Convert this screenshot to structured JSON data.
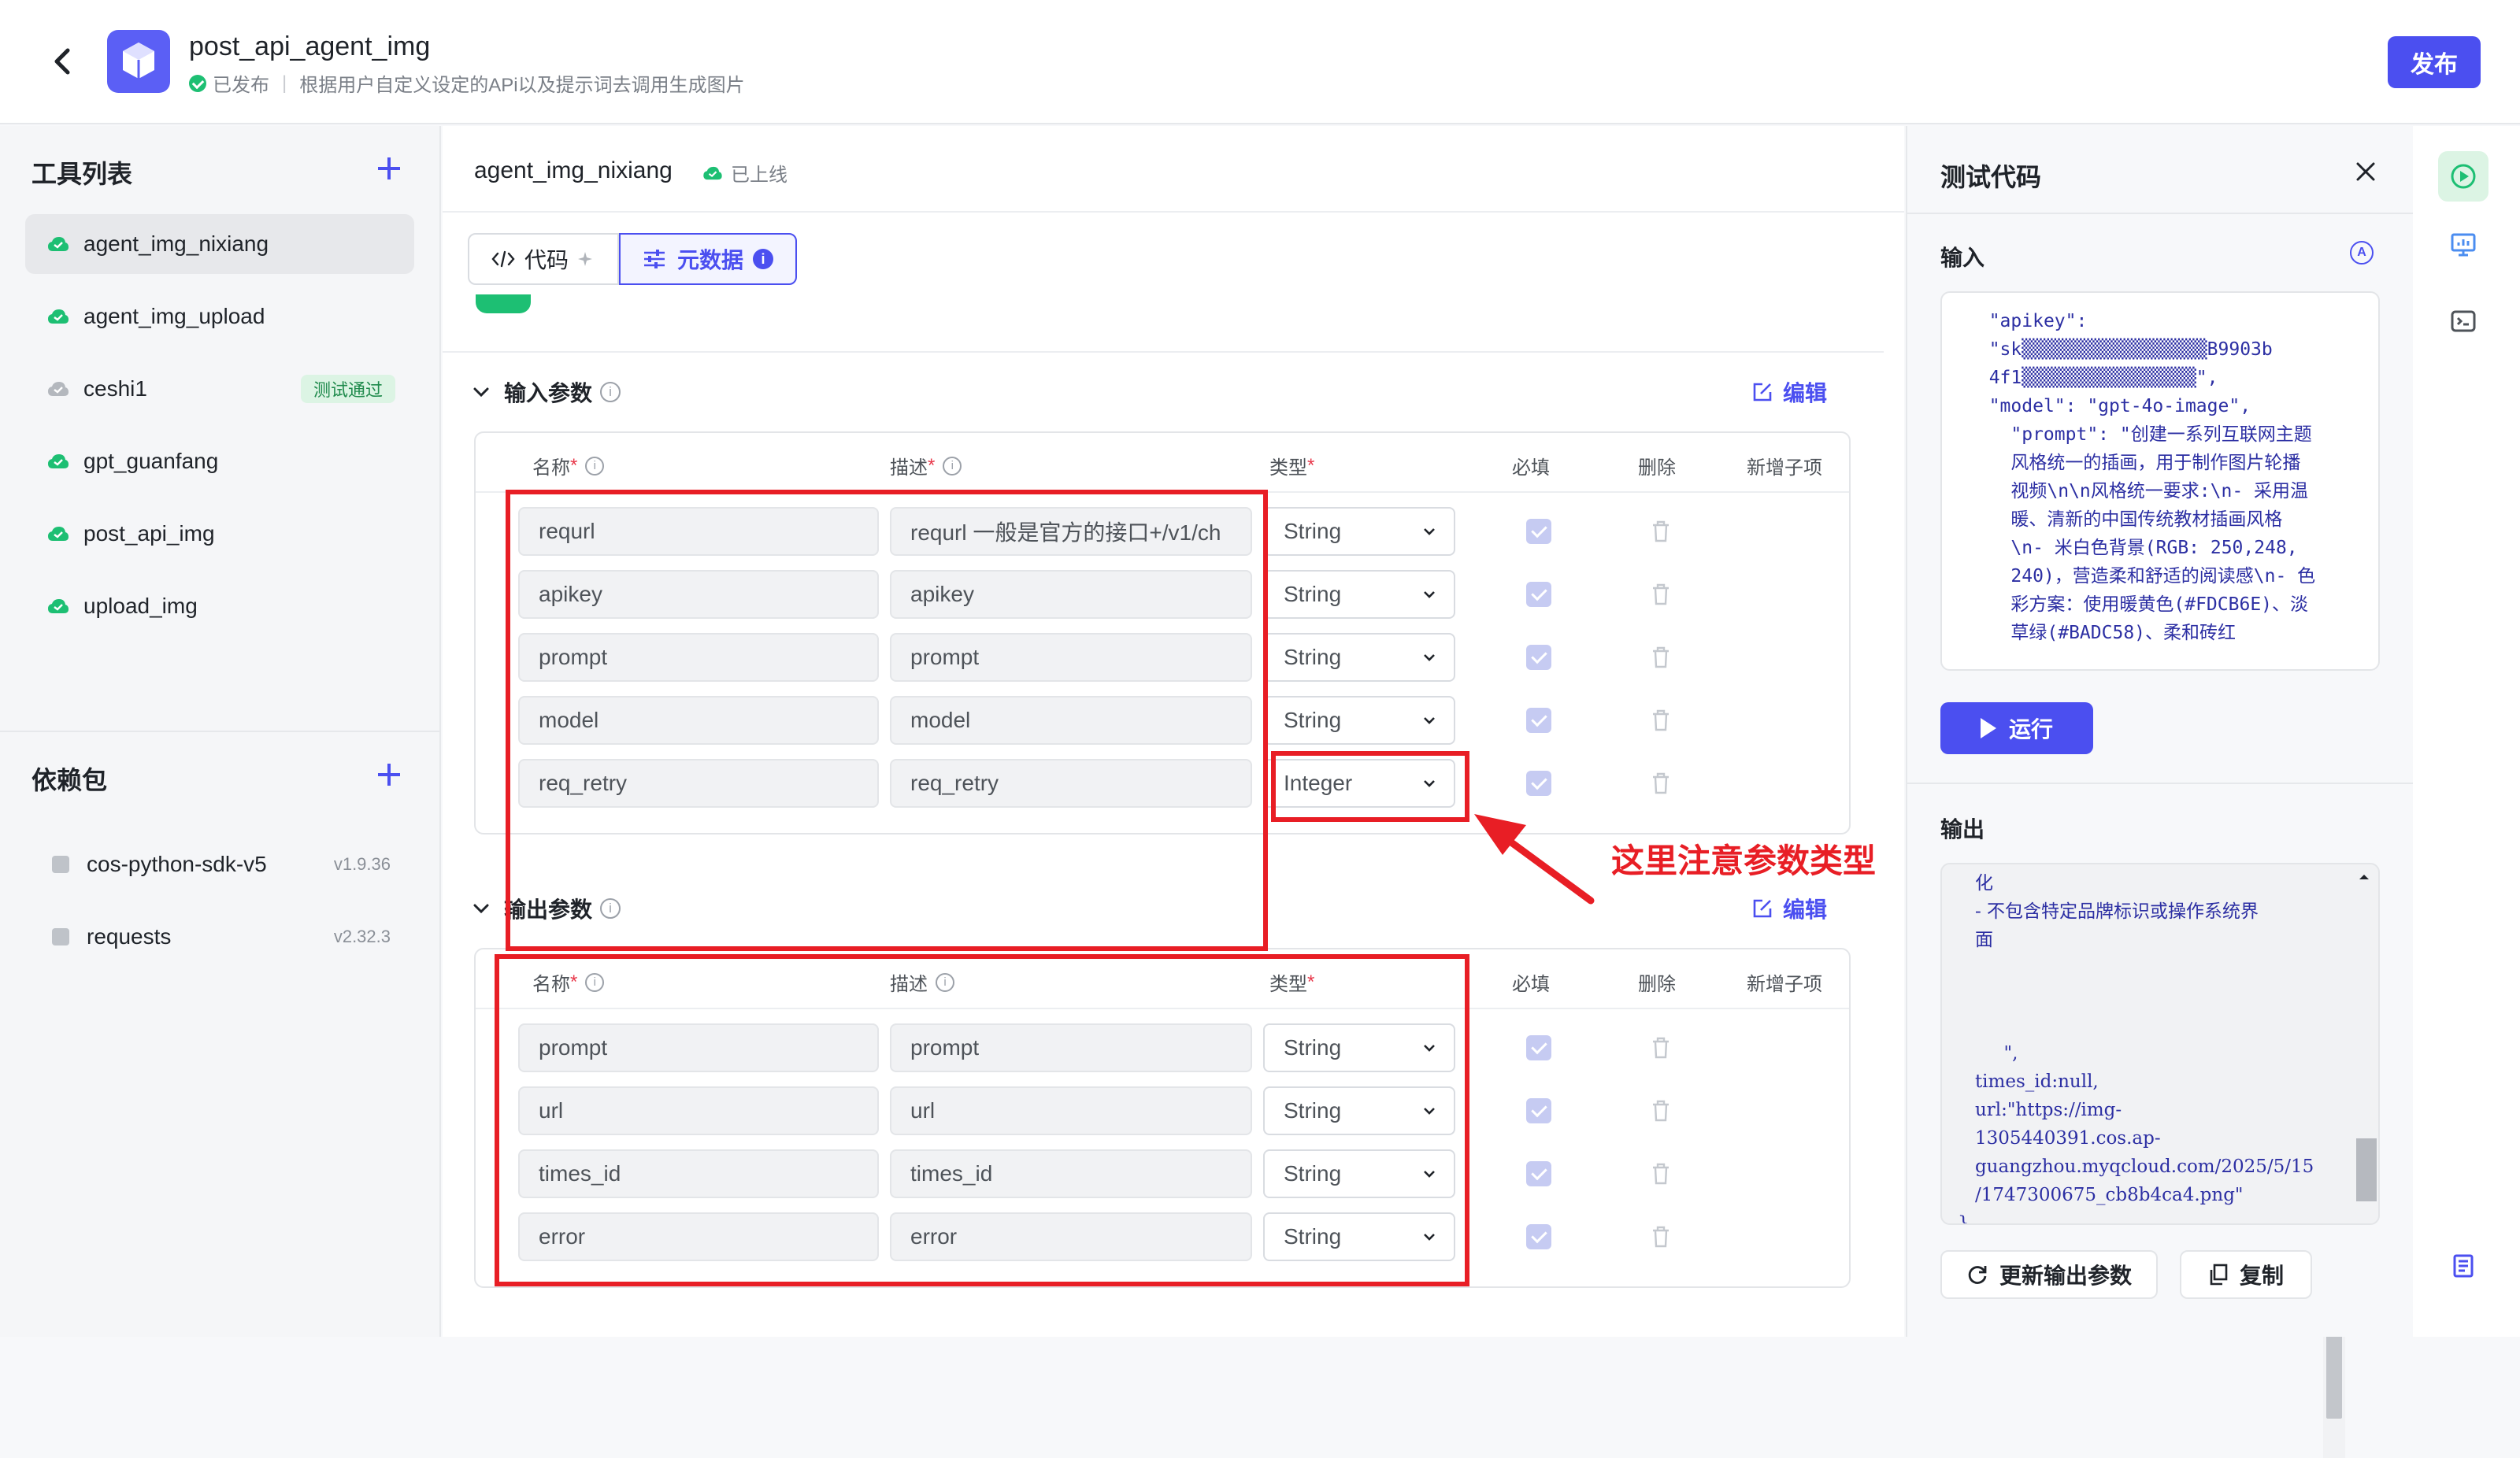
{
  "header": {
    "app_title": "post_api_agent_img",
    "status": "已发布",
    "description": "根据用户自定义设定的APi以及提示词去调用生成图片",
    "publish_label": "发布"
  },
  "tools": {
    "title": "工具列表",
    "items": [
      {
        "label": "agent_img_nixiang",
        "status": "green"
      },
      {
        "label": "agent_img_upload",
        "status": "green"
      },
      {
        "label": "ceshi1",
        "status": "grey",
        "badge": "测试通过"
      },
      {
        "label": "gpt_guanfang",
        "status": "green"
      },
      {
        "label": "post_api_img",
        "status": "green"
      },
      {
        "label": "upload_img",
        "status": "green"
      }
    ]
  },
  "deps": {
    "title": "依赖包",
    "items": [
      {
        "name": "cos-python-sdk-v5",
        "version": "v1.9.36"
      },
      {
        "name": "requests",
        "version": "v2.32.3"
      }
    ]
  },
  "editor": {
    "tool_name": "agent_img_nixiang",
    "online_status": "已上线",
    "tabs": [
      {
        "label": "代码"
      },
      {
        "label": "元数据"
      }
    ]
  },
  "input_params": {
    "title": "输入参数",
    "edit_label": "编辑",
    "columns": {
      "name": "名称",
      "desc": "描述",
      "type": "类型",
      "required": "必填",
      "delete": "删除",
      "add_child": "新增子项"
    },
    "rows": [
      {
        "name": "requrl",
        "desc": "requrl 一般是官方的接口+/v1/ch",
        "type": "String"
      },
      {
        "name": "apikey",
        "desc": "apikey",
        "type": "String"
      },
      {
        "name": "prompt",
        "desc": "prompt",
        "type": "String"
      },
      {
        "name": "model",
        "desc": "model",
        "type": "String"
      },
      {
        "name": "req_retry",
        "desc": "req_retry",
        "type": "Integer"
      }
    ]
  },
  "output_params": {
    "title": "输出参数",
    "edit_label": "编辑",
    "columns": {
      "name": "名称",
      "desc": "描述",
      "type": "类型",
      "required": "必填",
      "delete": "删除",
      "add_child": "新增子项"
    },
    "rows": [
      {
        "name": "prompt",
        "desc": "prompt",
        "type": "String"
      },
      {
        "name": "url",
        "desc": "url",
        "type": "String"
      },
      {
        "name": "times_id",
        "desc": "times_id",
        "type": "String"
      },
      {
        "name": "error",
        "desc": "error",
        "type": "String"
      }
    ]
  },
  "annotation": {
    "text": "这里注意参数类型"
  },
  "test_panel": {
    "title": "测试代码",
    "input_label": "输入",
    "input_code": "  \"apikey\":\n  \"sk▒▒▒▒▒▒▒▒▒▒▒▒▒▒▒▒▒B9903b\n  4f1▒▒▒▒▒▒▒▒▒▒▒▒▒▒▒▒\",\n  \"model\": \"gpt-4o-image\",\n    \"prompt\": \"创建一系列互联网主题\n    风格统一的插画，用于制作图片轮播\n    视频\\n\\n风格统一要求:\\n- 采用温\n    暖、清新的中国传统教材插画风格\n    \\n- 米白色背景(RGB: 250,248,\n    240)，营造柔和舒适的阅读感\\n- 色\n    彩方案：使用暖黄色(#FDCB6E)、淡\n    草绿(#BADC58)、柔和砖红",
    "run_label": "运行",
    "output_label": "输出",
    "output_code": "   化\n   - 不包含特定品牌标识或操作系统界\n   面\n\n\n\n        \",\n   times_id:null,\n   url:\"https://img-\n   1305440391.cos.ap-\n   guangzhou.myqcloud.com/2025/5/15\n   /1747300675_cb8b4ca4.png\"\n}",
    "update_label": "更新输出参数",
    "copy_label": "复制"
  },
  "colors": {
    "accent": "#4b4ff0",
    "success": "#1dbf73",
    "annotation": "#e81e25"
  }
}
